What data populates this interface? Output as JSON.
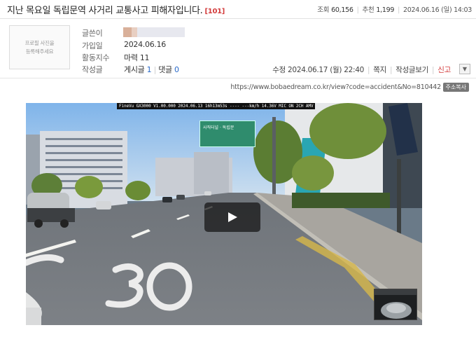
{
  "post": {
    "title": "지난 목요일 독립문역 사거리 교통사고 피해자입니다.",
    "comment_count": "[101]",
    "views_label": "조회",
    "views": "60,156",
    "recommend_label": "추천",
    "recommend": "1,199",
    "date": "2024.06.16 (일) 14:03"
  },
  "profile": {
    "photo_placeholder": "프로필 사진을\n등록해주세요",
    "author_label": "글쓴이",
    "joined_label": "가입일",
    "joined": "2024.06.16",
    "activity_label": "활동지수",
    "activity": "마력 11",
    "posts_label": "작성글",
    "posts_text": "게시글",
    "posts_count": "1",
    "comments_text": "댓글",
    "comments_count": "0"
  },
  "actions": {
    "edited": "수정 2024.06.17 (월) 22:40",
    "message": "쪽지",
    "view_posts": "작성글보기",
    "report": "신고"
  },
  "share": {
    "url": "https://www.bobaedream.co.kr/view?code=accident&No=810442",
    "copy_label": "주소복사"
  },
  "video": {
    "osd_text": "FineVu GX3000 V1.00.000 2024.06.13 16h13m53s ---- ---km/h 14.36V MIC ON  2CH AMV",
    "sign_text": "사직터널 · 독립문"
  },
  "colors": {
    "accent_red": "#d33c3c",
    "link_blue": "#2a6ac9"
  }
}
